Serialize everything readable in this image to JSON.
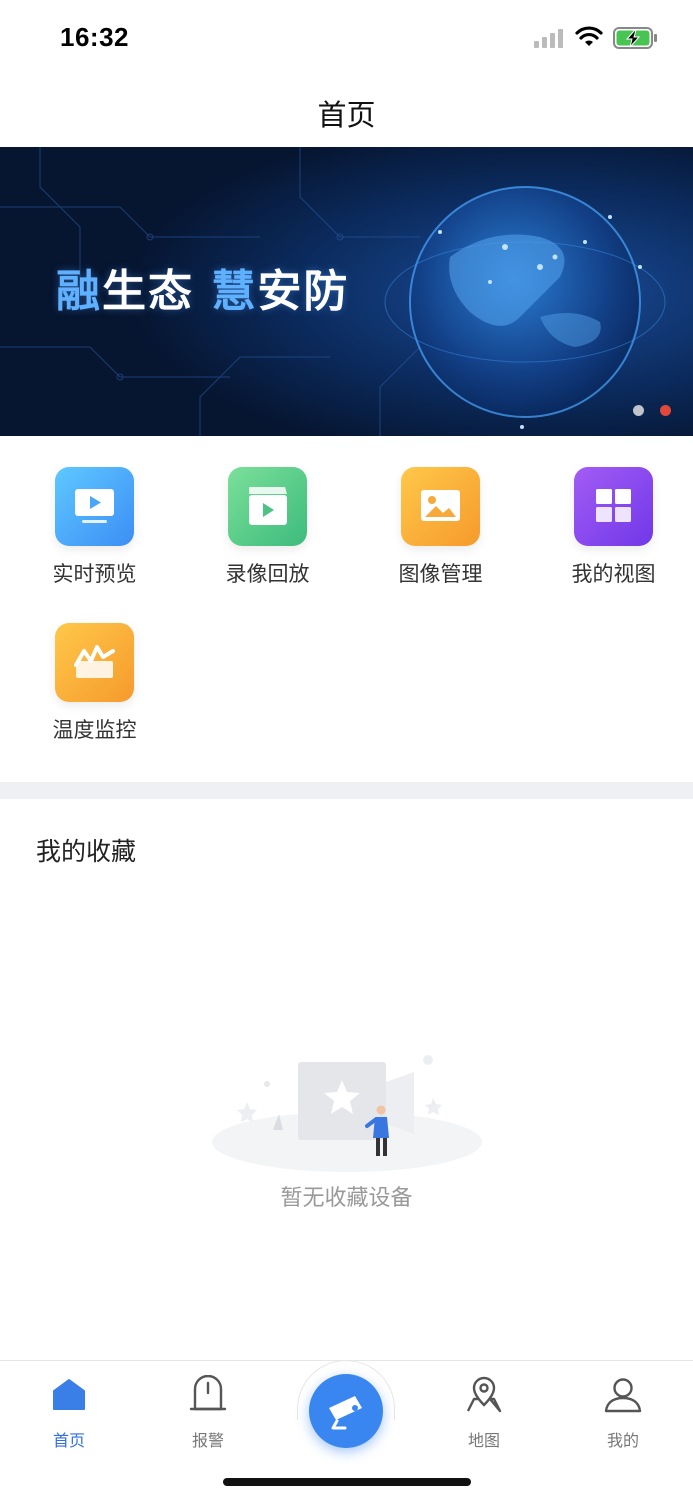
{
  "status_bar": {
    "time": "16:32"
  },
  "nav": {
    "title": "首页"
  },
  "banner": {
    "text_part1_highlight": "融",
    "text_part1": "生态 ",
    "text_part2_highlight": "慧",
    "text_part2": "安防",
    "page_count": 2,
    "active_page": 2
  },
  "apps": [
    {
      "label": "实时预览",
      "icon": "monitor-play-icon",
      "colors": [
        "#5ec8ff",
        "#3d8ef5"
      ]
    },
    {
      "label": "录像回放",
      "icon": "clapperboard-icon",
      "colors": [
        "#7be09a",
        "#3dbb7c"
      ]
    },
    {
      "label": "图像管理",
      "icon": "image-icon",
      "colors": [
        "#ffc84a",
        "#f59a2c"
      ]
    },
    {
      "label": "我的视图",
      "icon": "grid-view-icon",
      "colors": [
        "#a35cf5",
        "#7038e8"
      ]
    },
    {
      "label": "温度监控",
      "icon": "temperature-chart-icon",
      "colors": [
        "#ffc84a",
        "#f59a2c"
      ]
    }
  ],
  "favorites": {
    "title": "我的收藏",
    "empty_text": "暂无收藏设备"
  },
  "tabs": [
    {
      "label": "首页",
      "icon": "home-icon",
      "active": true
    },
    {
      "label": "报警",
      "icon": "alarm-icon",
      "active": false
    },
    {
      "label": "地图",
      "icon": "map-icon",
      "active": false
    },
    {
      "label": "我的",
      "icon": "user-icon",
      "active": false
    }
  ],
  "colors": {
    "accent": "#2f6fe0",
    "center_button": "#3a86f0",
    "banner_bg": "#071a3c",
    "divider": "#eef0f3",
    "dot_active": "#e2483a"
  }
}
